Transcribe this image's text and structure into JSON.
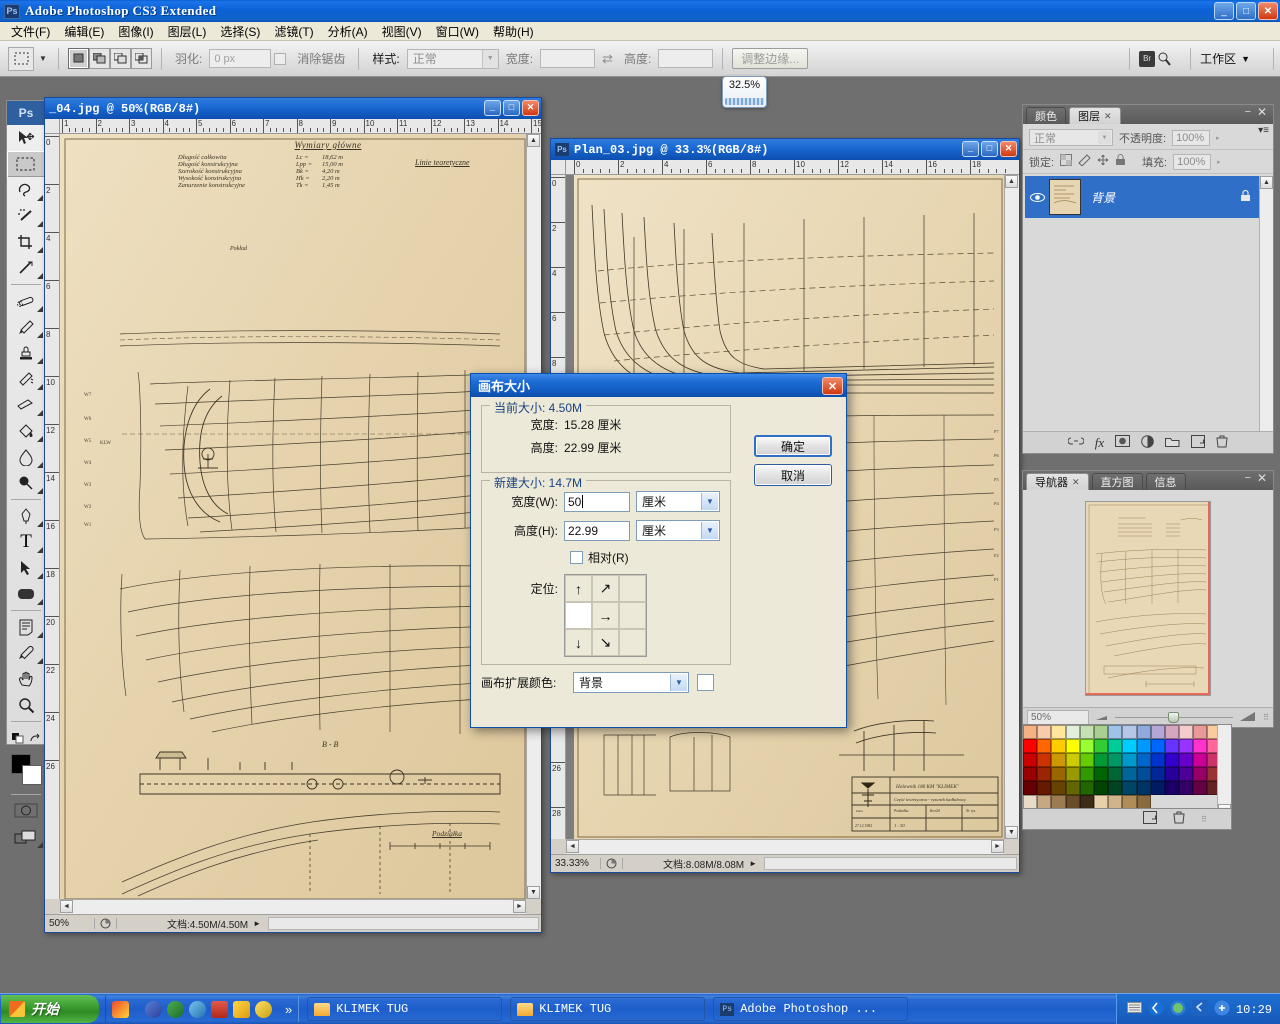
{
  "app": {
    "title": "Adobe Photoshop CS3 Extended",
    "logo": "Ps",
    "minimize": "_",
    "maximize": "□",
    "close": "✕"
  },
  "menu": [
    {
      "label": "文件(F)"
    },
    {
      "label": "编辑(E)"
    },
    {
      "label": "图像(I)"
    },
    {
      "label": "图层(L)"
    },
    {
      "label": "选择(S)"
    },
    {
      "label": "滤镜(T)"
    },
    {
      "label": "分析(A)"
    },
    {
      "label": "视图(V)"
    },
    {
      "label": "窗口(W)"
    },
    {
      "label": "帮助(H)"
    }
  ],
  "options_bar": {
    "feather_label": "羽化:",
    "feather_value": "0 px",
    "antialias_label": "消除锯齿",
    "style_label": "样式:",
    "style_value": "正常",
    "width_label": "宽度:",
    "width_value": "",
    "height_label": "高度:",
    "height_value": "",
    "refine_edge": "调整边缘...",
    "workspace": "工作区",
    "bridge_icon": "Br"
  },
  "zoom_tooltip": {
    "value": "32.5%"
  },
  "toolbox": {
    "logo": "Ps",
    "tools": [
      {
        "name": "move-tool",
        "glyph": "➤"
      },
      {
        "name": "rectangular-marquee-tool",
        "glyph": "▭"
      },
      {
        "name": "lasso-tool",
        "glyph": "ꔷ"
      },
      {
        "name": "magic-wand-tool",
        "glyph": "✳"
      },
      {
        "name": "crop-tool",
        "glyph": "✄"
      },
      {
        "name": "slice-tool",
        "glyph": "✂"
      },
      {
        "name": "healing-brush-tool",
        "glyph": "✑"
      },
      {
        "name": "brush-tool",
        "glyph": "🖌"
      },
      {
        "name": "clone-stamp-tool",
        "glyph": "⊥"
      },
      {
        "name": "history-brush-tool",
        "glyph": "✎"
      },
      {
        "name": "eraser-tool",
        "glyph": "▱"
      },
      {
        "name": "gradient-tool",
        "glyph": "◨"
      },
      {
        "name": "blur-tool",
        "glyph": "💧"
      },
      {
        "name": "dodge-tool",
        "glyph": "●"
      },
      {
        "name": "pen-tool",
        "glyph": "✒"
      },
      {
        "name": "type-tool",
        "glyph": "T"
      },
      {
        "name": "path-selection-tool",
        "glyph": "➚"
      },
      {
        "name": "shape-tool",
        "glyph": "▢"
      },
      {
        "name": "notes-tool",
        "glyph": "🗉"
      },
      {
        "name": "eyedropper-tool",
        "glyph": "✐"
      },
      {
        "name": "hand-tool",
        "glyph": "✋"
      },
      {
        "name": "zoom-tool",
        "glyph": "🔍"
      }
    ],
    "quickmask_label": "◯",
    "screenmode_label": "❐"
  },
  "documents": [
    {
      "title": "_04.jpg @ 50%(RGB/8#)",
      "zoom": "50%",
      "status": "文档:4.50M/4.50M",
      "ruler_ticks": [
        "1",
        "2",
        "3",
        "4",
        "5",
        "6",
        "7",
        "8",
        "9",
        "10",
        "11",
        "12",
        "13",
        "14",
        "15"
      ],
      "blueprint": {
        "heading": "Wymiary główne",
        "rows": [
          {
            "label": "Długość całkowita",
            "sym": "Lc  =",
            "val": "18,62 m"
          },
          {
            "label": "Długość konstrukcyjna",
            "sym": "Lpp =",
            "val": "15,00 m"
          },
          {
            "label": "Szerokość konstrukcyjna",
            "sym": "Bk  =",
            "val": "4,20 m"
          },
          {
            "label": "Wysokość konstrukcyjna",
            "sym": "Hk  =",
            "val": "2,20 m"
          },
          {
            "label": "Zanurzenie konstrukcyjne",
            "sym": "Tk  =",
            "val": "1,45 m"
          }
        ],
        "note_right": "Linie teoretyczne",
        "label_poklad": "Pokład",
        "label_bb": "B - B",
        "label_podzialka": "Podziałka"
      }
    },
    {
      "title": "Plan_03.jpg @ 33.3%(RGB/8#)",
      "zoom": "33.33%",
      "status": "文档:8.08M/8.08M",
      "ruler_ticks": [
        "0",
        "2",
        "4",
        "6",
        "8",
        "10",
        "12",
        "14",
        "16",
        "18"
      ],
      "titleblock": {
        "line1": "Holownik 180 KM \"KLIMEK\"",
        "line2": "Część teoretyczna - rysunek kadłubowy",
        "scale_label": "Podziałka",
        "scale": "1 : 50",
        "drawn_label": "Kreślił",
        "date_label": "Data",
        "date": "27.12.1982"
      }
    }
  ],
  "layers_panel": {
    "tabs": [
      {
        "label": "颜色",
        "active": false,
        "closable": false
      },
      {
        "label": "图层",
        "active": true,
        "closable": true
      }
    ],
    "blend_mode": "正常",
    "opacity_label": "不透明度:",
    "opacity_value": "100%",
    "lock_label": "锁定:",
    "fill_label": "填充:",
    "fill_value": "100%",
    "layer": {
      "name": "背景",
      "visible": true,
      "locked": true
    },
    "footer_icons": [
      "link-icon",
      "fx-icon",
      "mask-icon",
      "adjustment-icon",
      "group-icon",
      "new-layer-icon",
      "delete-layer-icon"
    ]
  },
  "navigator_panel": {
    "tabs": [
      {
        "label": "导航器",
        "active": true,
        "closable": true
      },
      {
        "label": "直方图",
        "active": false,
        "closable": false
      },
      {
        "label": "信息",
        "active": false,
        "closable": false
      }
    ],
    "zoom_value": "50%"
  },
  "swatches": {
    "colors": [
      "#f4b183",
      "#f8cbad",
      "#ffe699",
      "#e2efda",
      "#c6e0b4",
      "#a9d08e",
      "#9dc3e6",
      "#b4c7e7",
      "#8ea9db",
      "#b4a7d6",
      "#d5a6bd",
      "#f4cccc",
      "#ea9999",
      "#f9cb9d",
      "#ff0000",
      "#ff6600",
      "#ffcc00",
      "#ffff00",
      "#99ff33",
      "#33cc33",
      "#00cc99",
      "#00ccff",
      "#0099ff",
      "#0066ff",
      "#6633ff",
      "#9933ff",
      "#ff33cc",
      "#ff6699",
      "#cc0000",
      "#cc3300",
      "#cc9900",
      "#cccc00",
      "#66cc00",
      "#009933",
      "#009966",
      "#0099cc",
      "#0066cc",
      "#0033cc",
      "#3300cc",
      "#6600cc",
      "#cc0099",
      "#cc3366",
      "#990000",
      "#992600",
      "#996600",
      "#999900",
      "#339900",
      "#006600",
      "#006633",
      "#006699",
      "#004c99",
      "#002699",
      "#260099",
      "#4c0099",
      "#990066",
      "#993333",
      "#660000",
      "#661a00",
      "#664400",
      "#666600",
      "#226600",
      "#004400",
      "#004422",
      "#004466",
      "#003366",
      "#001a66",
      "#1a0066",
      "#330066",
      "#660044",
      "#662222",
      "#e8dcc8",
      "#c8a882",
      "#9c7b52",
      "#6b4c2a",
      "#3d2b18",
      "#e8d0a8",
      "#d2b48c",
      "#b08d57",
      "#8b6a3e",
      "",
      "",
      "",
      "",
      ""
    ]
  },
  "taskbar": {
    "start": "开始",
    "tasks": [
      {
        "label": "KLIMEK TUG",
        "icon": "folder-icon"
      },
      {
        "label": "KLIMEK TUG",
        "icon": "folder-icon"
      },
      {
        "label": "Adobe Photoshop ...",
        "icon": "ps-icon"
      }
    ],
    "clock": "10:29",
    "overflow": "»"
  },
  "dialog": {
    "title": "画布大小",
    "close": "✕",
    "current_size": {
      "legend": "当前大小: 4.50M",
      "width_label": "宽度:",
      "width_value": "15.28 厘米",
      "height_label": "高度:",
      "height_value": "22.99 厘米"
    },
    "new_size": {
      "legend": "新建大小: 14.7M",
      "width_label": "宽度(W):",
      "width_value": "50",
      "width_unit": "厘米",
      "height_label": "高度(H):",
      "height_value": "22.99",
      "height_unit": "厘米",
      "relative_label": "相对(R)",
      "relative_checked": false,
      "anchor_label": "定位:",
      "anchor_selected": "middle-left"
    },
    "extension_color_label": "画布扩展颜色:",
    "extension_color_value": "背景",
    "buttons": {
      "ok": "确定",
      "cancel": "取消"
    }
  }
}
